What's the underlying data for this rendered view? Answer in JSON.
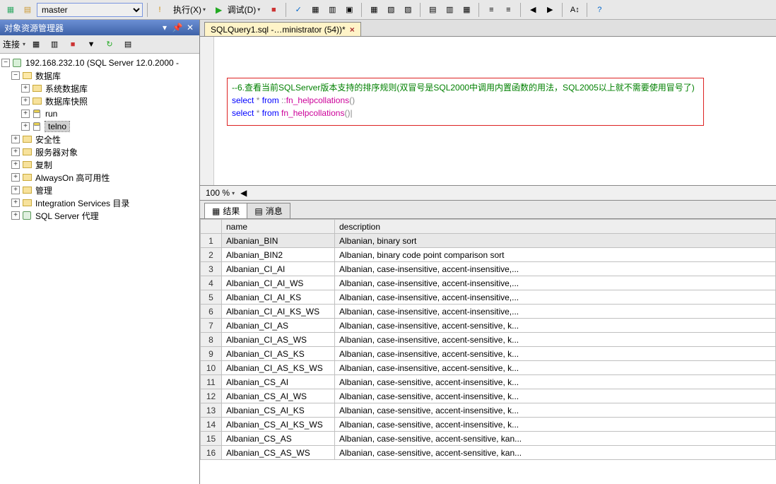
{
  "toolbar": {
    "combo_value": "master",
    "execute": "执行(X)",
    "debug": "调试(D)"
  },
  "sidebar": {
    "title": "对象资源管理器",
    "connect": "连接",
    "root": "192.168.232.10 (SQL Server 12.0.2000 -",
    "nodes": {
      "db": "数据库",
      "sysdb": "系统数据库",
      "dbsnap": "数据库快照",
      "run": "run",
      "telno": "telno",
      "security": "安全性",
      "serverobj": "服务器对象",
      "replication": "复制",
      "alwayson": "AlwaysOn 高可用性",
      "manage": "管理",
      "iscatalog": "Integration Services 目录",
      "sqlagent": "SQL Server 代理"
    }
  },
  "tab_label": "SQLQuery1.sql -…ministrator (54))*",
  "code": {
    "c1": "--6.查看当前SQLServer版本支持的排序规则(双冒号是SQL2000中调用内置函数的用法，SQL2005以上就不需要使用冒号了)",
    "l2a": "select",
    "l2b": " * ",
    "l2c": "from",
    "l2d": " ::",
    "l2e": "fn_helpcollations",
    "l2f": "()",
    "l3a": "select",
    "l3b": " * ",
    "l3c": "from",
    "l3d": " ",
    "l3e": "fn_helpcollations",
    "l3f": "()|"
  },
  "zoom": "100 %",
  "res_tabs": {
    "results": "结果",
    "messages": "消息"
  },
  "columns": {
    "blank": "",
    "name": "name",
    "desc": "description"
  },
  "rows": [
    {
      "n": "1",
      "name": "Albanian_BIN",
      "desc": "Albanian, binary sort"
    },
    {
      "n": "2",
      "name": "Albanian_BIN2",
      "desc": "Albanian, binary code point comparison sort"
    },
    {
      "n": "3",
      "name": "Albanian_CI_AI",
      "desc": "Albanian, case-insensitive, accent-insensitive,..."
    },
    {
      "n": "4",
      "name": "Albanian_CI_AI_WS",
      "desc": "Albanian, case-insensitive, accent-insensitive,..."
    },
    {
      "n": "5",
      "name": "Albanian_CI_AI_KS",
      "desc": "Albanian, case-insensitive, accent-insensitive,..."
    },
    {
      "n": "6",
      "name": "Albanian_CI_AI_KS_WS",
      "desc": "Albanian, case-insensitive, accent-insensitive,..."
    },
    {
      "n": "7",
      "name": "Albanian_CI_AS",
      "desc": "Albanian, case-insensitive, accent-sensitive, k..."
    },
    {
      "n": "8",
      "name": "Albanian_CI_AS_WS",
      "desc": "Albanian, case-insensitive, accent-sensitive, k..."
    },
    {
      "n": "9",
      "name": "Albanian_CI_AS_KS",
      "desc": "Albanian, case-insensitive, accent-sensitive, k..."
    },
    {
      "n": "10",
      "name": "Albanian_CI_AS_KS_WS",
      "desc": "Albanian, case-insensitive, accent-sensitive, k..."
    },
    {
      "n": "11",
      "name": "Albanian_CS_AI",
      "desc": "Albanian, case-sensitive, accent-insensitive, k..."
    },
    {
      "n": "12",
      "name": "Albanian_CS_AI_WS",
      "desc": "Albanian, case-sensitive, accent-insensitive, k..."
    },
    {
      "n": "13",
      "name": "Albanian_CS_AI_KS",
      "desc": "Albanian, case-sensitive, accent-insensitive, k..."
    },
    {
      "n": "14",
      "name": "Albanian_CS_AI_KS_WS",
      "desc": "Albanian, case-sensitive, accent-insensitive, k..."
    },
    {
      "n": "15",
      "name": "Albanian_CS_AS",
      "desc": "Albanian, case-sensitive, accent-sensitive, kan..."
    },
    {
      "n": "16",
      "name": "Albanian_CS_AS_WS",
      "desc": "Albanian, case-sensitive, accent-sensitive, kan..."
    }
  ]
}
